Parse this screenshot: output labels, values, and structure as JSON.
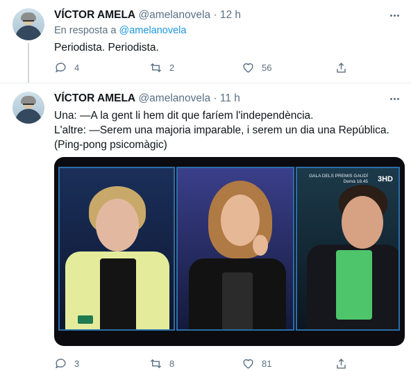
{
  "tweets": [
    {
      "author_name": "VÍCTOR AMELA",
      "handle": "@amelanovela",
      "separator": "·",
      "time": "12 h",
      "reply_prefix": "En resposta a",
      "reply_mention": "@amelanovela",
      "lines": [
        "Periodista. Periodista."
      ],
      "replies": "4",
      "retweets": "2",
      "likes": "56"
    },
    {
      "author_name": "VÍCTOR AMELA",
      "handle": "@amelanovela",
      "separator": "·",
      "time": "11 h",
      "lines": [
        "Una: —A la gent li hem dit que faríem l'independència.",
        "L'altre: —Serem una majoria imparable, i serem un dia una República.",
        "(Ping-pong psicomàgic)"
      ],
      "replies": "3",
      "retweets": "8",
      "likes": "81",
      "media": {
        "channel_logo": "3HD",
        "caption_line1": "GALA DELS PREMIS GAUDÍ",
        "caption_line2": "Demà 18.45"
      }
    }
  ],
  "icons": {
    "reply": "reply-icon",
    "retweet": "retweet-icon",
    "like": "heart-icon",
    "share": "share-icon",
    "more": "more-icon"
  },
  "colors": {
    "name": "#0f1419",
    "secondary": "#5b7083",
    "link": "#1b95e0",
    "divider": "#e6ecf0"
  }
}
